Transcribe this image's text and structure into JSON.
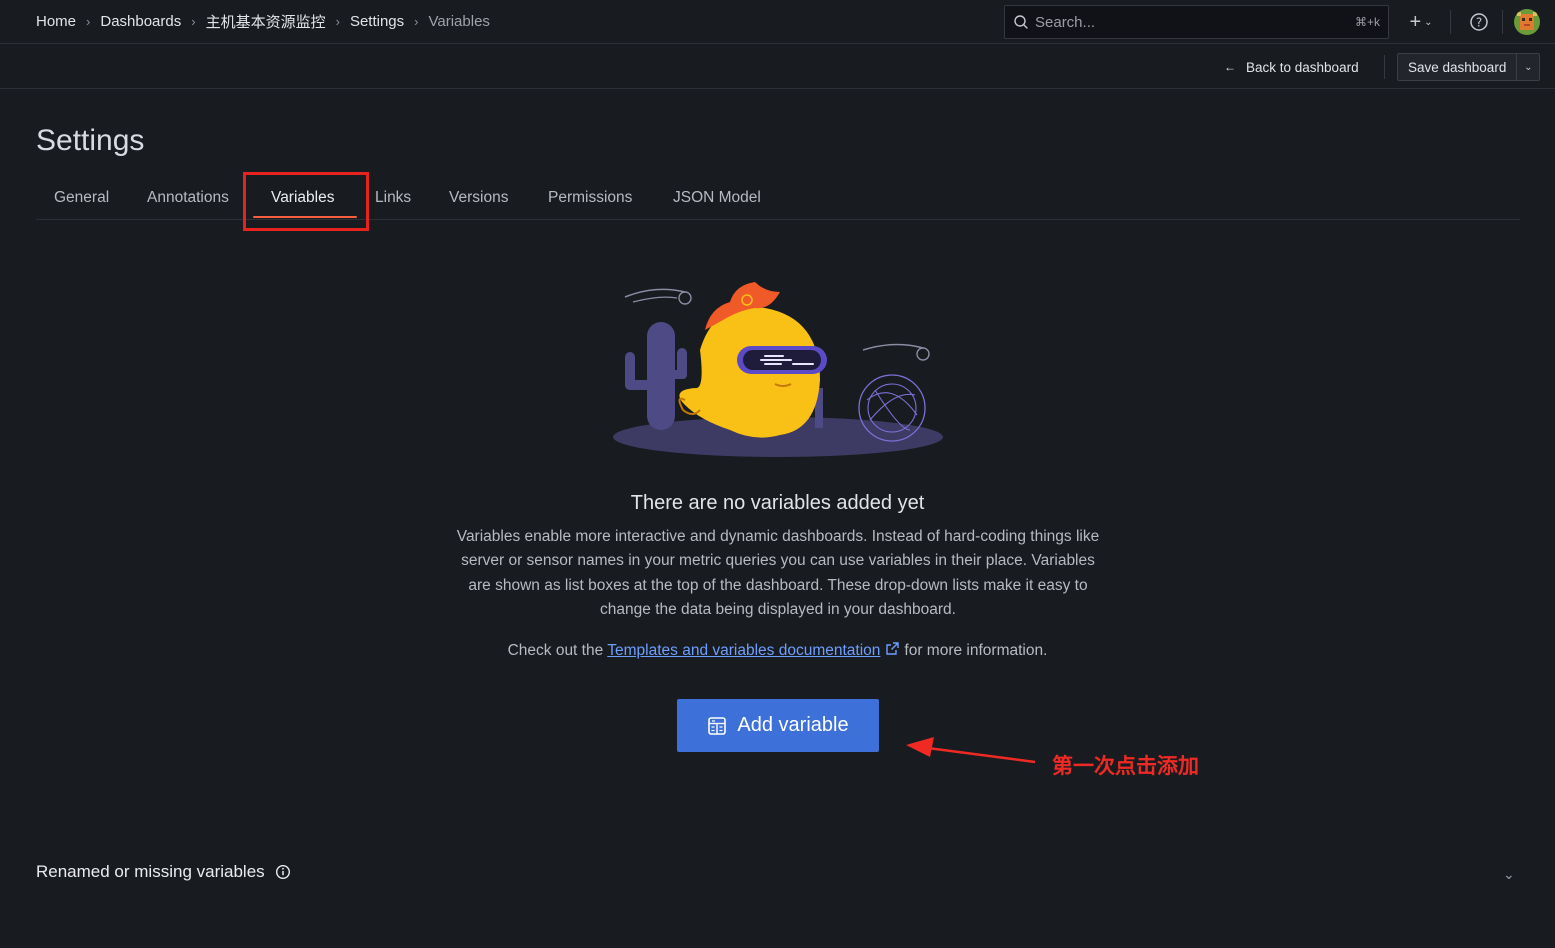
{
  "breadcrumb": [
    {
      "label": "Home"
    },
    {
      "label": "Dashboards"
    },
    {
      "label": "主机基本资源监控"
    },
    {
      "label": "Settings"
    },
    {
      "label": "Variables"
    }
  ],
  "search": {
    "placeholder": "Search...",
    "shortcut": "⌘+k"
  },
  "toolbar": {
    "back_label": "Back to dashboard",
    "save_label": "Save dashboard"
  },
  "page": {
    "title": "Settings"
  },
  "tabs": [
    {
      "label": "General"
    },
    {
      "label": "Annotations"
    },
    {
      "label": "Variables",
      "active": true
    },
    {
      "label": "Links"
    },
    {
      "label": "Versions"
    },
    {
      "label": "Permissions"
    },
    {
      "label": "JSON Model"
    }
  ],
  "empty_state": {
    "title": "There are no variables added yet",
    "description": "Variables enable more interactive and dynamic dashboards. Instead of hard-coding things like server or sensor names in your metric queries you can use variables in their place. Variables are shown as list boxes at the top of the dashboard. These drop-down lists make it easy to change the data being displayed in your dashboard.",
    "link_prefix": "Check out the",
    "link_text": "Templates and variables documentation",
    "link_suffix": "for more information.",
    "button_label": "Add variable"
  },
  "annotation": {
    "text": "第一次点击添加",
    "color": "#ef2a24"
  },
  "renamed_section": {
    "label": "Renamed or missing variables"
  },
  "colors": {
    "accent": "#3d71d9",
    "tab_underline": "#f55f3e",
    "link": "#6e9fff",
    "highlight": "#e8231f"
  }
}
